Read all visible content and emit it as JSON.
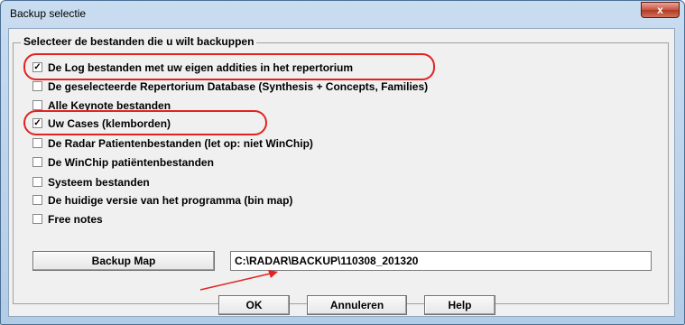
{
  "window": {
    "title": "Backup selectie",
    "close_label": "x"
  },
  "group": {
    "label": "Selecteer de bestanden die u wilt backuppen"
  },
  "options": [
    {
      "label": "De Log bestanden met uw eigen addities in het repertorium",
      "checked": true
    },
    {
      "label": "De geselecteerde Repertorium Database (Synthesis + Concepts, Families)",
      "checked": false
    },
    {
      "label": "Alle Keynote bestanden",
      "checked": false
    },
    {
      "label": "Uw Cases (klemborden)",
      "checked": true
    },
    {
      "label": "De Radar Patientenbestanden (let op: niet WinChip)",
      "checked": false
    },
    {
      "label": "De WinChip patiëntenbestanden",
      "checked": false
    },
    {
      "label": "Systeem bestanden",
      "checked": false
    },
    {
      "label": "De huidige versie van het programma (bin map)",
      "checked": false
    },
    {
      "label": "Free notes",
      "checked": false
    }
  ],
  "backup": {
    "button_label": "Backup Map",
    "path_value": "C:\\RADAR\\BACKUP\\110308_201320"
  },
  "buttons": {
    "ok": "OK",
    "cancel": "Annuleren",
    "help": "Help"
  },
  "colors": {
    "highlight": "#e32222",
    "titlebar": "#c9dcf0"
  }
}
